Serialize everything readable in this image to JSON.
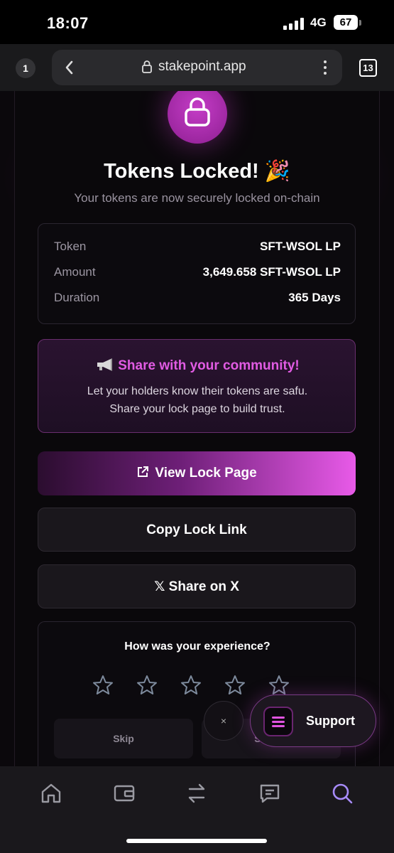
{
  "status_bar": {
    "time": "18:07",
    "network": "4G",
    "battery": "67"
  },
  "browser": {
    "tab_indicator": "1",
    "url": "stakepoint.app",
    "tab_count": "13"
  },
  "hero": {
    "lock_icon": "lock-icon",
    "title": "Tokens Locked! 🎉",
    "subtitle": "Your tokens are now securely locked on-chain"
  },
  "details": [
    {
      "label": "Token",
      "value": "SFT-WSOL LP"
    },
    {
      "label": "Amount",
      "value": "3,649.658 SFT-WSOL LP"
    },
    {
      "label": "Duration",
      "value": "365 Days"
    }
  ],
  "share": {
    "title": "Share with your community!",
    "line1": "Let your holders know their tokens are safu.",
    "line2": "Share your lock page to build trust."
  },
  "buttons": {
    "view_lock_page": "View Lock Page",
    "copy_lock_link": "Copy Lock Link",
    "share_on_x": "𝕏 Share on X"
  },
  "experience": {
    "title": "How was your experience?",
    "stars": 5,
    "skip": "Skip",
    "submit": "Submit"
  },
  "widgets": {
    "close": "×",
    "support": "Support"
  },
  "bottom_nav": [
    "home-icon",
    "wallet-icon",
    "swap-icon",
    "chat-icon",
    "search-icon"
  ],
  "colors": {
    "accent": "#e15be3",
    "active_nav": "#a78bfa"
  }
}
